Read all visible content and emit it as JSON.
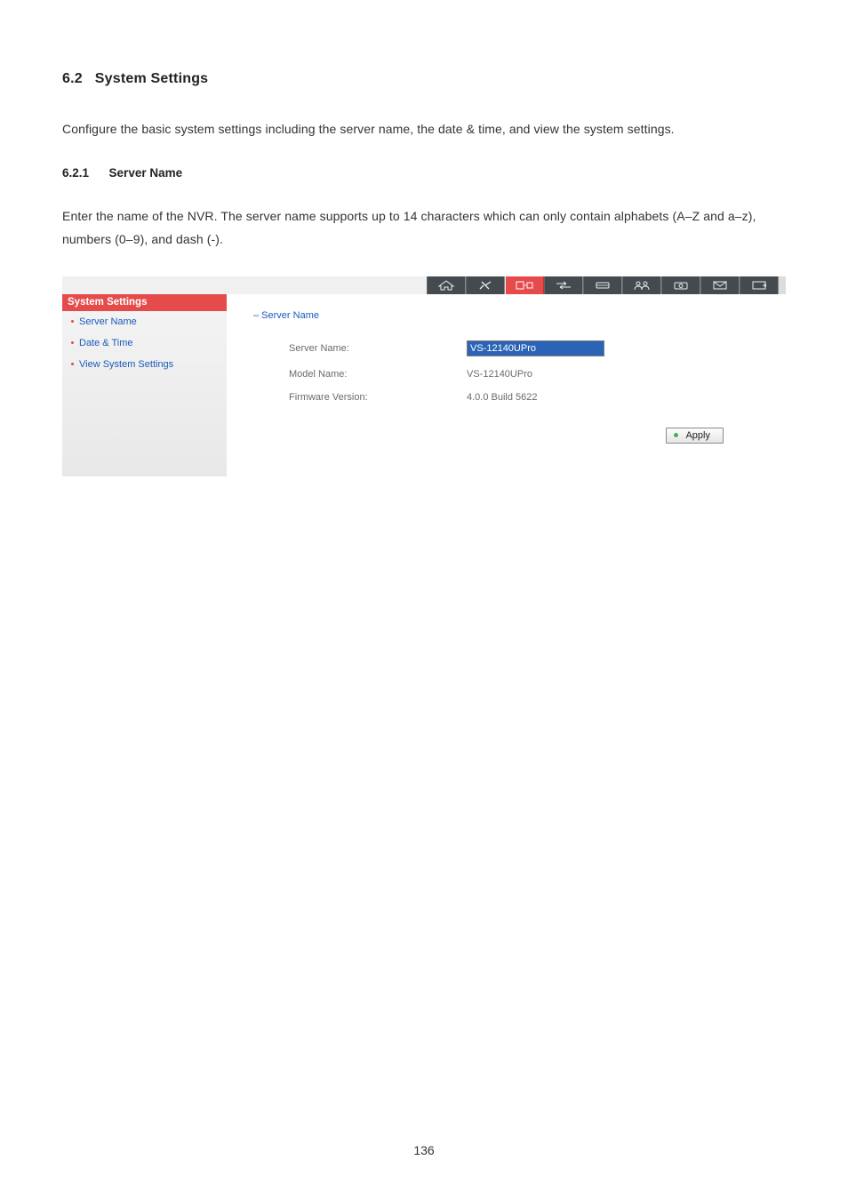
{
  "page_number": "136",
  "section": {
    "number": "6.2",
    "title": "System Settings",
    "intro": "Configure the basic system settings including the server name, the date & time, and view the system settings."
  },
  "subsection": {
    "number": "6.2.1",
    "title": "Server Name",
    "intro": "Enter the name of the NVR.   The server name supports up to 14 characters which can only contain alphabets (A–Z and a–z), numbers (0–9), and dash (-)."
  },
  "ui": {
    "topbar_icons": [
      {
        "name": "house-icon",
        "bg": "dark"
      },
      {
        "name": "plug-icon",
        "bg": "dark"
      },
      {
        "name": "contacts-icon",
        "bg": "red"
      },
      {
        "name": "arrows-icon",
        "bg": "dark"
      },
      {
        "name": "drive-icon",
        "bg": "dark"
      },
      {
        "name": "users-icon",
        "bg": "dark"
      },
      {
        "name": "camera-icon",
        "bg": "dark"
      },
      {
        "name": "envelope-icon",
        "bg": "dark"
      },
      {
        "name": "log-icon",
        "bg": "dark"
      }
    ],
    "sidebar": {
      "header": "System Settings",
      "items": [
        {
          "label": "Server Name",
          "id": "server-name"
        },
        {
          "label": "Date & Time",
          "id": "date-time"
        },
        {
          "label": "View System Settings",
          "id": "view-system-settings"
        }
      ]
    },
    "panel": {
      "heading": "– Server Name",
      "server_name_label": "Server Name:",
      "server_name_value": "VS-12140UPro",
      "model_name_label": "Model Name:",
      "model_name_value": "VS-12140UPro",
      "firmware_label": "Firmware Version:",
      "firmware_value": "4.0.0 Build 5622",
      "apply_label": "Apply"
    }
  }
}
